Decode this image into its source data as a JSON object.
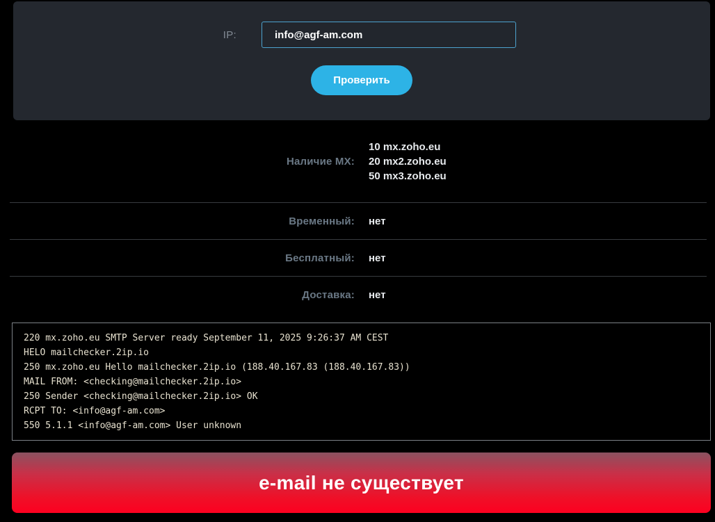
{
  "form": {
    "ip_label": "IP:",
    "input_value": "info@agf-am.com",
    "submit_label": "Проверить"
  },
  "results": [
    {
      "label": "Наличие MX:",
      "values": [
        "10 mx.zoho.eu",
        "20 mx2.zoho.eu",
        "50 mx3.zoho.eu"
      ]
    },
    {
      "label": "Временный:",
      "values": [
        "нет"
      ]
    },
    {
      "label": "Бесплатный:",
      "values": [
        "нет"
      ]
    },
    {
      "label": "Доставка:",
      "values": [
        "нет"
      ]
    }
  ],
  "smtp_log": [
    "220 mx.zoho.eu SMTP Server ready September 11, 2025 9:26:37 AM CEST",
    "HELO mailchecker.2ip.io",
    "250 mx.zoho.eu Hello mailchecker.2ip.io (188.40.167.83 (188.40.167.83))",
    "MAIL FROM: <checking@mailchecker.2ip.io>",
    "250 Sender <checking@mailchecker.2ip.io> OK",
    "RCPT TO: <info@agf-am.com>",
    "550 5.1.1 <info@agf-am.com> User unknown"
  ],
  "banner": {
    "text": "e-mail не существует"
  },
  "colors": {
    "accent_blue": "#2db3e6",
    "input_border_blue": "#4da3cf",
    "panel_bg": "#24282f",
    "page_bg": "#000000",
    "error_red": "#fd0020",
    "label_gray_blue": "#6a7885",
    "log_text": "#e8e2d0"
  }
}
